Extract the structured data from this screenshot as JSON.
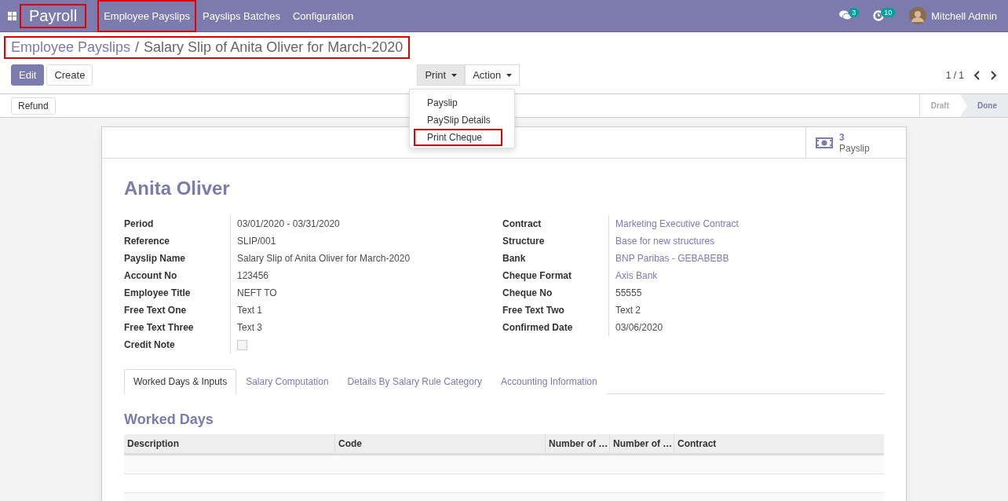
{
  "navbar": {
    "app_name": "Payroll",
    "app_highlighted": true,
    "menu": [
      {
        "label": "Employee Payslips",
        "highlighted": true
      },
      {
        "label": "Payslips Batches",
        "highlighted": false
      },
      {
        "label": "Configuration",
        "highlighted": false
      }
    ],
    "messages_count": "3",
    "activities_count": "10",
    "user": "Mitchell Admin"
  },
  "breadcrumb": {
    "parent": "Employee Payslips",
    "separator": "/",
    "current": "Salary Slip of Anita Oliver for March-2020",
    "highlighted": true
  },
  "buttons": [
    "Edit",
    "Create"
  ],
  "print_menu": {
    "label": "Print",
    "expanded": true,
    "items": [
      {
        "label": "Payslip",
        "highlighted": false
      },
      {
        "label": "PaySlip Details",
        "highlighted": false
      },
      {
        "label": "Print Cheque",
        "highlighted": true
      }
    ]
  },
  "action_menu": {
    "label": "Action"
  },
  "pager": "1 / 1",
  "status_bar": {
    "buttons": [
      "Refund"
    ],
    "stages": [
      {
        "label": "Draft",
        "selected": false
      },
      {
        "label": "Done",
        "selected": true
      }
    ]
  },
  "smart_button": {
    "count": "3",
    "label": "Payslip"
  },
  "employee": "Anita Oliver",
  "left_fields": [
    {
      "label": "Period",
      "value": "03/01/2020 - 03/31/2020",
      "kind": "text"
    },
    {
      "label": "Reference",
      "value": "SLIP/001",
      "kind": "text"
    },
    {
      "label": "Payslip Name",
      "value": "Salary Slip of Anita Oliver for March-2020",
      "kind": "text"
    },
    {
      "label": "Account No",
      "value": "123456",
      "kind": "text"
    },
    {
      "label": "Employee Title",
      "value": "NEFT TO",
      "kind": "text"
    },
    {
      "label": "Free Text One",
      "value": "Text 1",
      "kind": "text"
    },
    {
      "label": "Free Text Three",
      "value": "Text 3",
      "kind": "text"
    },
    {
      "label": "Credit Note",
      "checked": false,
      "kind": "checkbox"
    }
  ],
  "right_fields": [
    {
      "label": "Contract",
      "value": "Marketing Executive Contract",
      "kind": "link"
    },
    {
      "label": "Structure",
      "value": "Base for new structures",
      "kind": "link"
    },
    {
      "label": "Bank",
      "value": "BNP Paribas - GEBABEBB",
      "kind": "link"
    },
    {
      "label": "Cheque Format",
      "value": "Axis Bank",
      "kind": "link"
    },
    {
      "label": "Cheque No",
      "value": "55555",
      "kind": "text"
    },
    {
      "label": "Free Text Two",
      "value": "Text 2",
      "kind": "text"
    },
    {
      "label": "Confirmed Date",
      "value": "03/06/2020",
      "kind": "text"
    }
  ],
  "tabs": [
    {
      "label": "Worked Days & Inputs",
      "selected": true
    },
    {
      "label": "Salary Computation",
      "selected": false
    },
    {
      "label": "Details By Salary Rule Category",
      "selected": false
    },
    {
      "label": "Accounting Information",
      "selected": false
    }
  ],
  "section_title": "Worked Days",
  "table": {
    "columns": [
      "Description",
      "Code",
      "Number of …",
      "Number of …",
      "Contract"
    ]
  }
}
